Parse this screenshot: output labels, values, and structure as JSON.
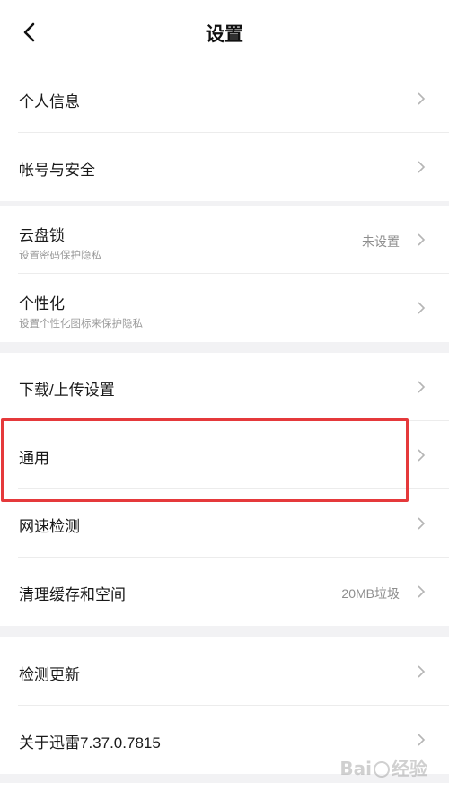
{
  "header": {
    "title": "设置"
  },
  "groups": [
    {
      "items": [
        {
          "label": "个人信息"
        },
        {
          "label": "帐号与安全"
        }
      ]
    },
    {
      "items": [
        {
          "label": "云盘锁",
          "sublabel": "设置密码保护隐私",
          "value": "未设置"
        },
        {
          "label": "个性化",
          "sublabel": "设置个性化图标来保护隐私"
        }
      ]
    },
    {
      "items": [
        {
          "label": "下载/上传设置"
        },
        {
          "label": "通用"
        },
        {
          "label": "网速检测"
        },
        {
          "label": "清理缓存和空间",
          "value": "20MB垃圾"
        }
      ]
    },
    {
      "items": [
        {
          "label": "检测更新"
        },
        {
          "label": "关于迅雷7.37.0.7815"
        }
      ]
    }
  ],
  "watermark": {
    "text_left": "Bai",
    "text_right": "经验"
  },
  "colors": {
    "highlight": "#e5393b",
    "background": "#f2f2f4"
  }
}
